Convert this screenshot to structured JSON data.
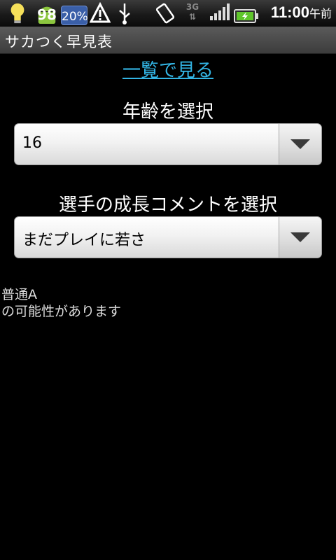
{
  "status_bar": {
    "battery_percent_badge": "98",
    "weather_percent": "20%",
    "network": "3G",
    "time": "11:00",
    "ampm": "午前",
    "icons": [
      "lightbulb-icon",
      "android-icon",
      "weather-icon",
      "warning-icon",
      "usb-icon",
      "rotate-icon",
      "3g-icon",
      "signal-icon",
      "battery-icon"
    ]
  },
  "title": "サカつく早見表",
  "list_link": "一覧で見る",
  "age": {
    "label": "年齢を選択",
    "selected": "16"
  },
  "comment": {
    "label": "選手の成長コメントを選択",
    "selected": "まだプレイに若さ"
  },
  "result": {
    "line1": "普通A",
    "line2": "の可能性があります"
  }
}
